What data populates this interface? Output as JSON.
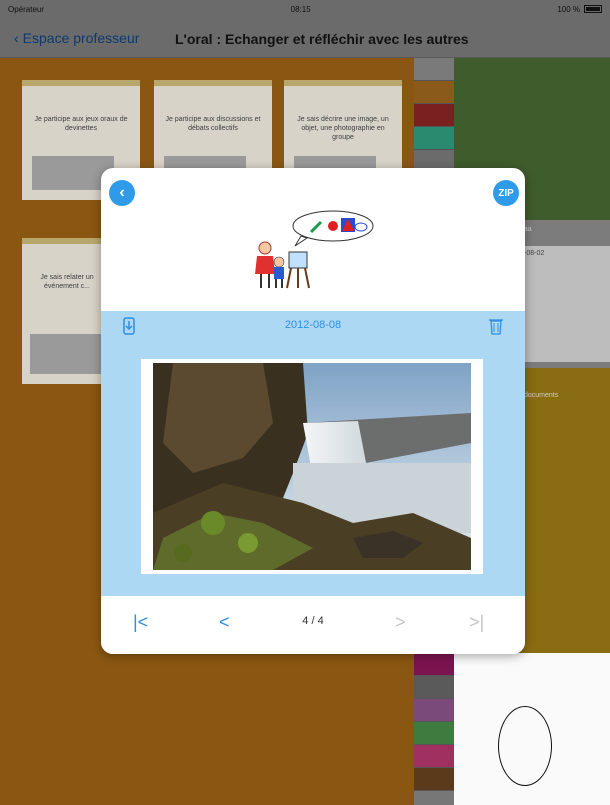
{
  "status": {
    "carrier": "Opérateur",
    "time": "08:15",
    "battery": "100 %"
  },
  "nav": {
    "back_label": "Espace professeur",
    "title": "L'oral : Echanger et réfléchir avec les autres"
  },
  "cards": [
    {
      "text": "Je participe aux jeux oraux de devinettes"
    },
    {
      "text": "Je participe aux discussions et débats collectifs"
    },
    {
      "text": "Je sais décrire une image, un objet, une photographie en groupe"
    },
    {
      "text": "Je sais relater un événement c..."
    }
  ],
  "right_panel": {
    "date_label": "-08-02",
    "docs_label": "documents",
    "tag_label": "aaa"
  },
  "modal": {
    "zip_label": "ZIP",
    "date": "2012-08-08",
    "pager": {
      "first": "|<",
      "prev": "<",
      "count": "4 / 4",
      "next": ">",
      "last": ">|"
    }
  },
  "colors": {
    "accent": "#2f8ee0",
    "panel": "#add8f4"
  },
  "icons": [
    "back-chevron-icon",
    "zip-icon",
    "download-icon",
    "trash-icon"
  ]
}
